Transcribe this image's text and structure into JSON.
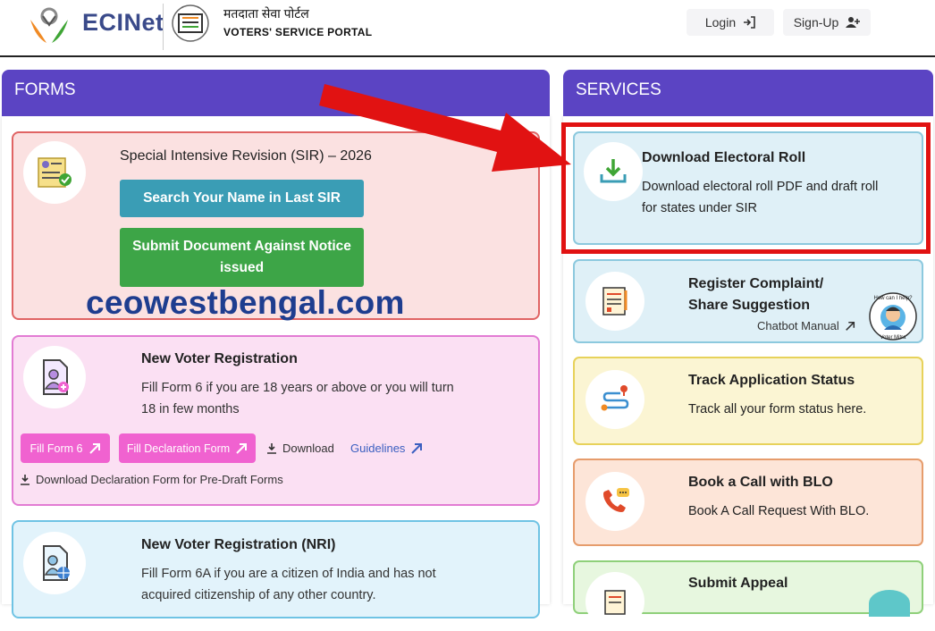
{
  "header": {
    "brand": "ECINet",
    "portal_hindi": "मतदाता सेवा पोर्टल",
    "portal_english": "VOTERS' SERVICE PORTAL",
    "login_label": "Login",
    "signup_label": "Sign-Up"
  },
  "forms": {
    "title": "FORMS",
    "sir": {
      "title": "Special Intensive Revision (SIR) – 2026",
      "search_button": "Search Your Name in Last SIR",
      "submit_button": "Submit Document Against Notice issued"
    },
    "watermark": "ceowestbengal.com",
    "new_voter": {
      "title": "New Voter Registration",
      "description": "Fill Form 6 if you are 18 years or above or you will turn 18 in few months",
      "fill_form6": "Fill Form 6",
      "fill_declaration": "Fill Declaration Form",
      "download": "Download",
      "guidelines": "Guidelines",
      "predraft": "Download Declaration Form for Pre-Draft Forms"
    },
    "nri": {
      "title": "New Voter Registration (NRI)",
      "description": "Fill Form 6A if you are a citizen of India and has not acquired citizenship of any other country."
    }
  },
  "services": {
    "title": "SERVICES",
    "items": [
      {
        "title": "Download Electoral Roll",
        "description": "Download electoral roll PDF and draft roll for states under SIR"
      },
      {
        "title": "Register Complaint/ Share Suggestion",
        "link": "Chatbot Manual",
        "badge_top": "How can I help?",
        "badge_bottom": "Voter Mitra"
      },
      {
        "title": "Track Application Status",
        "description": "Track all your form status here."
      },
      {
        "title": "Book a Call with BLO",
        "description": "Book A Call Request With BLO."
      },
      {
        "title": "Submit Appeal"
      }
    ]
  },
  "colors": {
    "panel_header": "#5b44c3",
    "highlight": "#e11212",
    "sir_button": "#3a9db5",
    "submit_button": "#3da547",
    "pink_button": "#f062d0"
  }
}
